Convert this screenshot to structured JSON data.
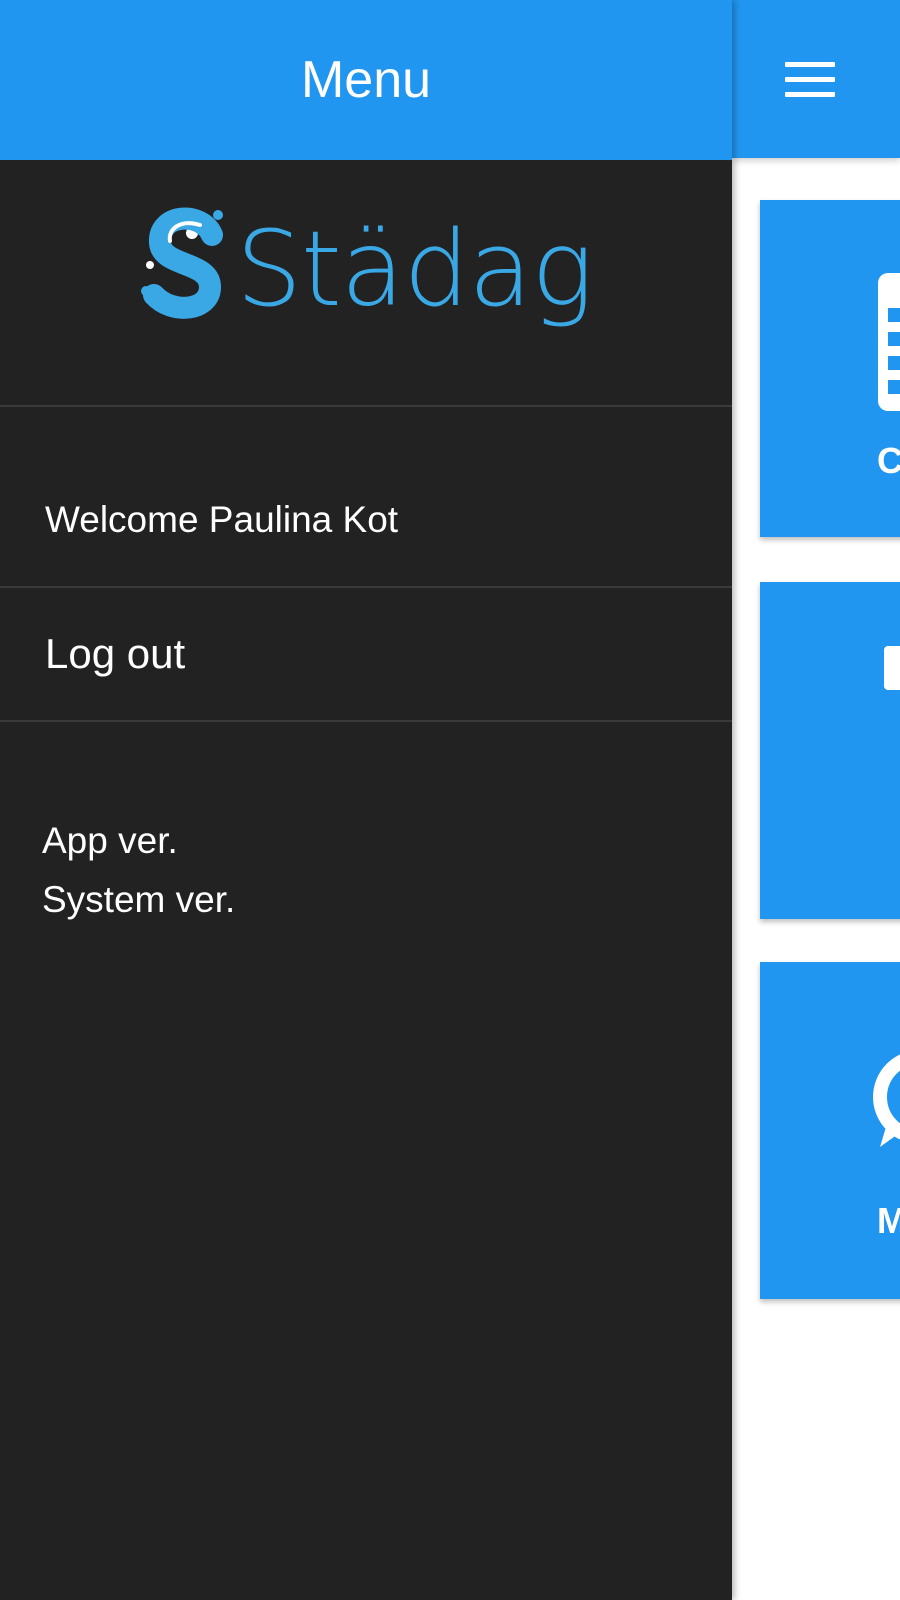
{
  "drawer": {
    "title": "Menu",
    "logo_text": "Städago",
    "welcome": "Welcome Paulina Kot",
    "logout": "Log out",
    "app_version_label": "App ver.",
    "system_version_label": "System ver."
  },
  "main": {
    "menu_icon": "hamburger-icon",
    "tiles": [
      {
        "label_fragment": "C",
        "icon": "calendar-icon"
      },
      {
        "label_fragment": "",
        "icon": "document-icon"
      },
      {
        "label_fragment": "M",
        "icon": "chat-icon"
      }
    ]
  },
  "colors": {
    "primary": "#2196f0",
    "drawer_bg": "#222222",
    "logo_blue": "#3ba8e6"
  }
}
